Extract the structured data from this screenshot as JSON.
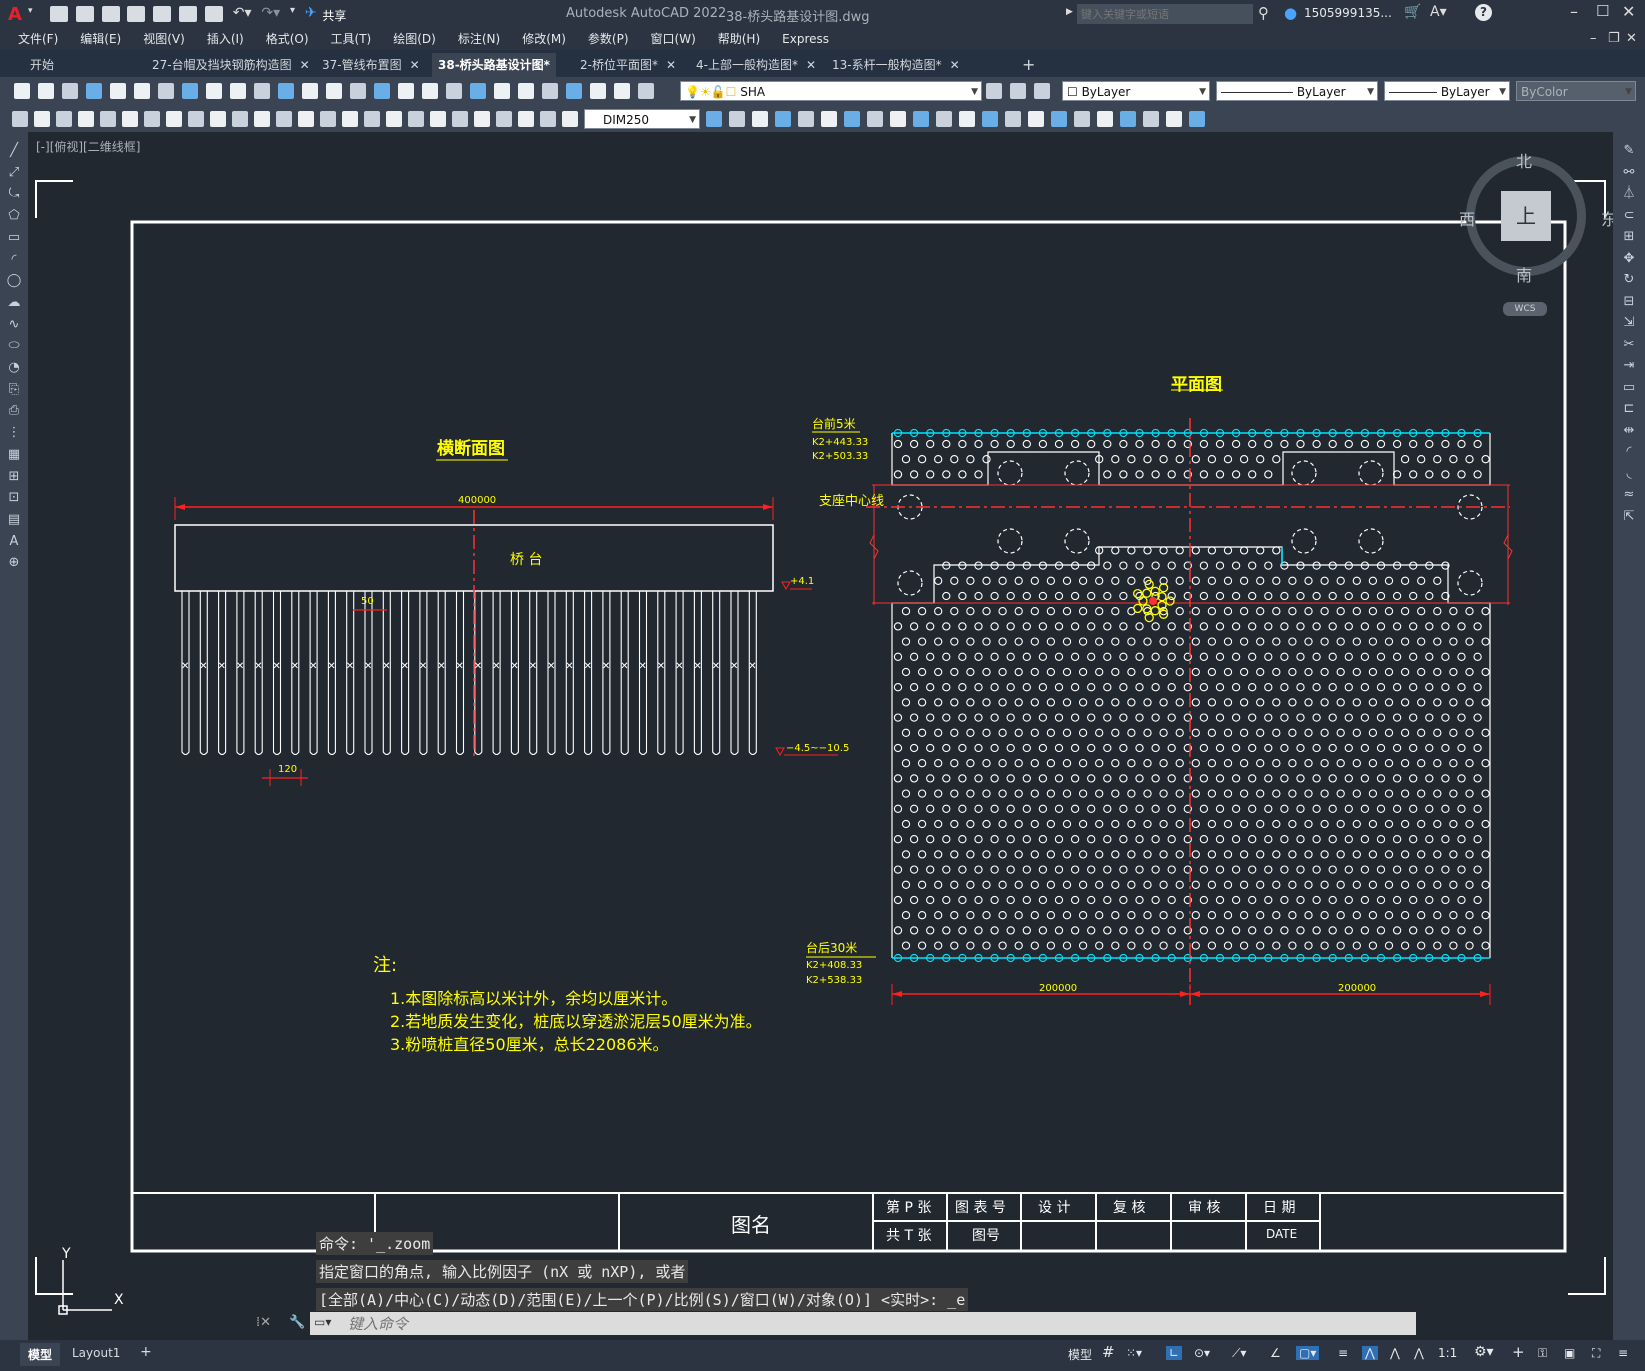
{
  "app": {
    "title": "Autodesk AutoCAD 2022",
    "file": "38-桥头路基设计图.dwg",
    "share": "共享",
    "search_placeholder": "键入关键字或短语",
    "user": "1505999135...",
    "logo": "A"
  },
  "menu": [
    "文件(F)",
    "编辑(E)",
    "视图(V)",
    "插入(I)",
    "格式(O)",
    "工具(T)",
    "绘图(D)",
    "标注(N)",
    "修改(M)",
    "参数(P)",
    "窗口(W)",
    "帮助(H)",
    "Express"
  ],
  "tabs": [
    {
      "label": "开始",
      "active": false,
      "closable": false
    },
    {
      "label": "27-台帽及挡块钢筋构造图",
      "active": false,
      "closable": true
    },
    {
      "label": "37-管线布置图",
      "active": false,
      "closable": true
    },
    {
      "label": "38-桥头路基设计图*",
      "active": true,
      "closable": false
    },
    {
      "label": "2-桥位平面图*",
      "active": false,
      "closable": true
    },
    {
      "label": "4-上部一般构造图*",
      "active": false,
      "closable": true
    },
    {
      "label": "13-系杆一般构造图*",
      "active": false,
      "closable": true
    }
  ],
  "toolbar": {
    "layer": "SHA",
    "color": "ByLayer",
    "linetype": "ByLayer",
    "lineweight": "ByLayer",
    "plotstyle": "ByColor",
    "dimstyle": "DIM250"
  },
  "viewport_label": "[-][俯视][二维线框]",
  "viewcube": {
    "north": "北",
    "south": "南",
    "east": "东",
    "west": "西",
    "top": "上",
    "wcs": "WCS"
  },
  "drawing": {
    "cross_section": {
      "title": "横断面图",
      "dim_total": "400000",
      "abutment": "桥 台",
      "dim_pile": "50",
      "dim_spacing": "120",
      "elev_top": "+4.1",
      "elev_bottom": "−4.5~−10.5"
    },
    "plan": {
      "title": "平面图",
      "front_label": "台前5米",
      "front_k1": "K2+443.33",
      "front_k2": "K2+503.33",
      "bearing": "支座中心线",
      "back_label": "台后30米",
      "back_k1": "K2+408.33",
      "back_k2": "K2+538.33",
      "dim_left": "200000",
      "dim_right": "200000"
    },
    "notes": {
      "title": "注:",
      "n1": "1.本图除标高以米计外，余均以厘米计。",
      "n2": "2.若地质发生变化，桩底以穿透淤泥层50厘米为准。",
      "n3": "3.粉喷桩直径50厘米，总长22086米。"
    },
    "titleblock": {
      "drawing_name": "图名",
      "sheet_p": "第 P 张",
      "sheet_t": "共 T 张",
      "table_no": "图 表 号",
      "fig_no": "图号",
      "design": "设 计",
      "review": "复 核",
      "audit": "审 核",
      "date_label": "日 期",
      "date_value": "DATE"
    }
  },
  "command": {
    "line1": "命令: '_.zoom",
    "line2": "指定窗口的角点, 输入比例因子 (nX 或 nXP), 或者",
    "line3": "[全部(A)/中心(C)/动态(D)/范围(E)/上一个(P)/比例(S)/窗口(W)/对象(O)] <实时>: _e",
    "placeholder": "键入命令"
  },
  "ucs": {
    "x": "X",
    "y": "Y"
  },
  "status": {
    "model_tab": "模型",
    "layout_tab": "Layout1",
    "add_tab": "+",
    "model": "模型",
    "scale": "1:1"
  },
  "colors": {
    "yellow": "#ffff00",
    "red": "#ff0000",
    "cyan": "#00ffff",
    "white": "#ffffff",
    "bg": "#212830"
  }
}
